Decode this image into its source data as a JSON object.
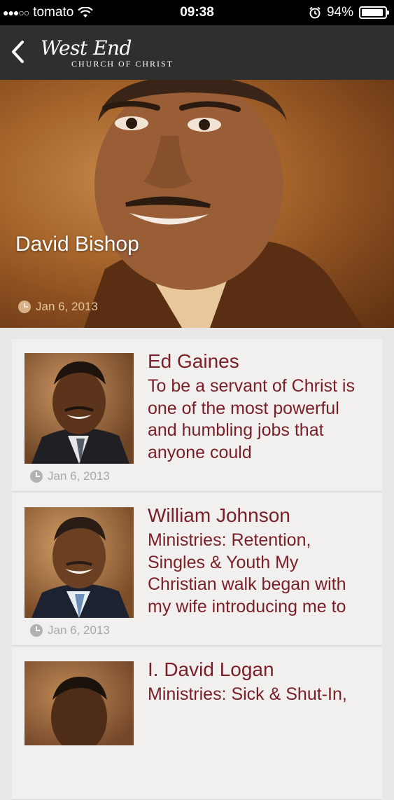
{
  "status": {
    "carrier": "tomato",
    "signal_dots": "●●●○○",
    "time": "09:38",
    "battery_percent": "94%",
    "battery_level": 0.94
  },
  "navbar": {
    "back_icon": "chevron-left-icon",
    "logo_script": "West End",
    "logo_sub": "CHURCH OF CHRIST"
  },
  "hero": {
    "name": "David Bishop",
    "date": "Jan 6, 2013"
  },
  "items": [
    {
      "name": "Ed Gaines",
      "excerpt": "To be a servant of Christ is one of the most powerful and humbling jobs that anyone could",
      "date": "Jan 6, 2013"
    },
    {
      "name": "William Johnson",
      "excerpt": "Ministries: Retention, Singles & Youth My Christian walk began with my wife introducing me to",
      "date": "Jan 6, 2013"
    },
    {
      "name": "I. David Logan",
      "excerpt": "Ministries: Sick & Shut-In,",
      "date": ""
    }
  ],
  "colors": {
    "accent": "#7a1f27",
    "navbar": "#2f2f2f",
    "background": "#e9e8e7"
  }
}
